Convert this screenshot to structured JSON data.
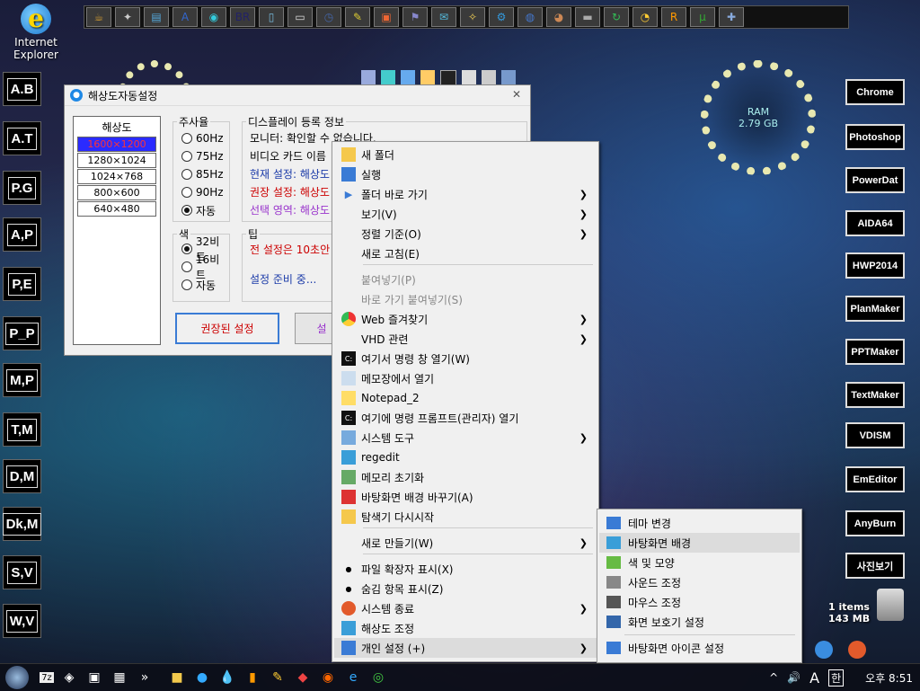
{
  "desktop": {
    "ie_label_line1": "Internet",
    "ie_label_line2": "Explorer",
    "left_launchers": [
      "A.B",
      "A.T",
      "P.G",
      "A,P",
      "P,E",
      "P_P",
      "M,P",
      "T,M",
      "D,M",
      "Dk,M",
      "S,V",
      "W,V"
    ],
    "right_launchers": [
      "Chrome",
      "Photoshop",
      "PowerDat",
      "AIDA64",
      "HWP2014",
      "PlanMaker",
      "PPTMaker",
      "TextMaker",
      "VDISM",
      "EmEditor",
      "AnyBurn",
      "사진보기"
    ],
    "ram_label": "RAM",
    "ram_value": "2.79 GB",
    "recycle_items": "1 items",
    "recycle_size": "143 MB",
    "top_dock_icons": [
      "java-icon",
      "tools-icon",
      "folder-icon",
      "a-icon",
      "globe-icon",
      "br-icon",
      "doc-icon",
      "drive-icon",
      "restore-icon",
      "pen-icon",
      "box-icon",
      "user-icon",
      "network-icon",
      "wand-icon",
      "gear-icon",
      "earth-icon",
      "cake-icon",
      "usb-icon",
      "refresh-icon",
      "clock-icon",
      "r-icon",
      "torrent-icon",
      "puzzle-icon"
    ]
  },
  "window": {
    "title": "해상도자동설정",
    "close": "✕",
    "resolution": {
      "title": "해상도",
      "items": [
        "1600×1200",
        "1280×1024",
        "1024×768",
        "800×600",
        "640×480"
      ],
      "selected_index": 0
    },
    "refresh": {
      "title": "주사율",
      "options": [
        "60Hz",
        "75Hz",
        "85Hz",
        "90Hz",
        "자동"
      ],
      "selected_index": 4
    },
    "color": {
      "title": "색",
      "options": [
        "32비트",
        "16비트",
        "자동"
      ],
      "selected_index": 0
    },
    "display_info": {
      "title": "디스플레이 등록 정보",
      "monitor": "모니터: 확인할 수 없습니다.",
      "video_card": "비디오 카드 이름",
      "current": "현재 설정: 해상도",
      "recommended": "권장 설정: 해상도",
      "selected": "선택 영역: 해상도"
    },
    "tip": {
      "title": "팁",
      "line1": "전 설정은 10초안",
      "line2": "설정 준비 중..."
    },
    "recommend_button": "권장된 설정",
    "second_button": "설"
  },
  "context_menu": {
    "items": [
      {
        "label": "새 폴더",
        "icon": "folder-icon",
        "arrow": false,
        "disabled": false
      },
      {
        "label": "실행",
        "icon": "run-icon",
        "arrow": false,
        "disabled": false
      },
      {
        "label": "폴더 바로 가기",
        "icon": "play-arrow-icon",
        "arrow": true,
        "disabled": false
      },
      {
        "label": "보기(V)",
        "icon": "",
        "arrow": true,
        "disabled": false
      },
      {
        "label": "정렬 기준(O)",
        "icon": "",
        "arrow": true,
        "disabled": false
      },
      {
        "label": "새로 고침(E)",
        "icon": "",
        "arrow": false,
        "disabled": false
      },
      {
        "label": "붙여넣기(P)",
        "icon": "",
        "arrow": false,
        "disabled": true
      },
      {
        "label": "바로 가기 붙여넣기(S)",
        "icon": "",
        "arrow": false,
        "disabled": true
      },
      {
        "label": "Web 즐겨찾기",
        "icon": "chrome-icon",
        "arrow": true,
        "disabled": false
      },
      {
        "label": "VHD 관련",
        "icon": "vhd-icon",
        "arrow": true,
        "disabled": false
      },
      {
        "label": "여기서 명령 창 열기(W)",
        "icon": "cmd-icon",
        "arrow": false,
        "disabled": false
      },
      {
        "label": "메모장에서 열기",
        "icon": "notepad-icon",
        "arrow": false,
        "disabled": false
      },
      {
        "label": "Notepad_2",
        "icon": "notepad2-icon",
        "arrow": false,
        "disabled": false
      },
      {
        "label": "여기에 명령 프롬프트(관리자) 열기",
        "icon": "cmd-admin-icon",
        "arrow": false,
        "disabled": false
      },
      {
        "label": "시스템 도구",
        "icon": "system-tools-icon",
        "arrow": true,
        "disabled": false
      },
      {
        "label": "regedit",
        "icon": "regedit-icon",
        "arrow": false,
        "disabled": false
      },
      {
        "label": "메모리 초기화",
        "icon": "memory-icon",
        "arrow": false,
        "disabled": false
      },
      {
        "label": "바탕화면 배경 바꾸기(A)",
        "icon": "wallpaper-icon",
        "arrow": false,
        "disabled": false
      },
      {
        "label": "탐색기 다시시작",
        "icon": "explorer-icon",
        "arrow": false,
        "disabled": false
      },
      {
        "label": "새로 만들기(W)",
        "icon": "",
        "arrow": true,
        "disabled": false
      },
      {
        "label": "파일 확장자 표시(X)",
        "icon": "bullet-icon",
        "arrow": false,
        "disabled": false
      },
      {
        "label": "숨김 항목 표시(Z)",
        "icon": "bullet-icon",
        "arrow": false,
        "disabled": false
      },
      {
        "label": "시스템 종료",
        "icon": "power-icon",
        "arrow": true,
        "disabled": false
      },
      {
        "label": "해상도 조정",
        "icon": "display-icon",
        "arrow": false,
        "disabled": false
      },
      {
        "label": "개인 설정 (+)",
        "icon": "personalize-icon",
        "arrow": true,
        "disabled": false
      }
    ]
  },
  "submenu": {
    "items": [
      {
        "label": "테마 변경",
        "icon": "theme-icon"
      },
      {
        "label": "바탕화면 배경",
        "icon": "desktop-background-icon"
      },
      {
        "label": "색 및 모양",
        "icon": "color-icon"
      },
      {
        "label": "사운드 조정",
        "icon": "sound-icon"
      },
      {
        "label": "마우스 조정",
        "icon": "mouse-icon"
      },
      {
        "label": "화면 보호기 설정",
        "icon": "screensaver-icon"
      },
      {
        "label": "바탕화면 아이콘 설정",
        "icon": "desktop-icons-icon"
      }
    ]
  },
  "taskbar": {
    "ime": "A",
    "lang": "한",
    "time": "오후 8:51",
    "chevron": "^",
    "volume": "🔊"
  },
  "colors": {
    "accent": "#2b2bff",
    "recommend_border": "#3a7bd5",
    "warn_red": "#cc0000",
    "info_blue": "#1a3aa8",
    "info_purple": "#9933cc"
  }
}
